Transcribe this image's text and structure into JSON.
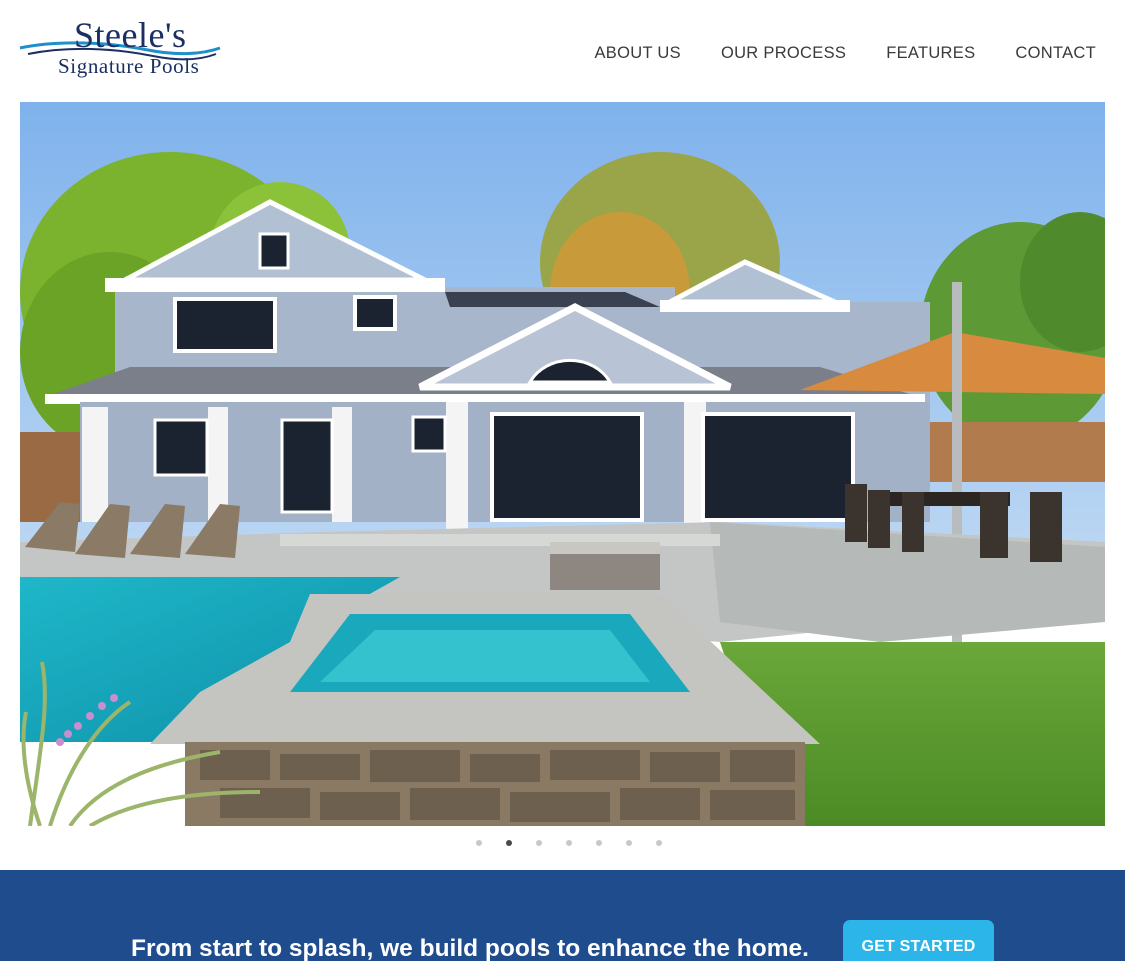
{
  "brand": {
    "name_line1": "Steele's",
    "name_line2": "Signature Pools",
    "logo_icon": "wave-swoosh-icon",
    "color_primary": "#1b2f63",
    "color_accent": "#1e8fc9"
  },
  "nav": {
    "items": [
      {
        "label": "ABOUT US"
      },
      {
        "label": "OUR PROCESS"
      },
      {
        "label": "FEATURES"
      },
      {
        "label": "CONTACT"
      }
    ]
  },
  "hero": {
    "description_icon": "house-with-pool-photo",
    "slide_count": 7,
    "active_slide": 2
  },
  "cta": {
    "text": "From start to splash, we build pools to enhance the home.",
    "button_label": "GET STARTED",
    "band_color": "#1e4c8c",
    "button_color": "#2bb5e8"
  }
}
